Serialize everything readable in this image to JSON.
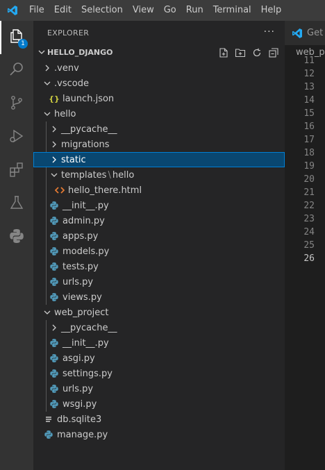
{
  "menu": [
    "File",
    "Edit",
    "Selection",
    "View",
    "Go",
    "Run",
    "Terminal",
    "Help"
  ],
  "activity": {
    "explorer_badge": "1"
  },
  "sidebar": {
    "title": "EXPLORER",
    "more": "···",
    "section_title": "HELLO_DJANGO",
    "items": [
      {
        "label": ".venv"
      },
      {
        "label": ".vscode"
      },
      {
        "label": "launch.json"
      },
      {
        "label": "hello"
      },
      {
        "label": "__pycache__"
      },
      {
        "label": "migrations"
      },
      {
        "label": "static"
      },
      {
        "label": "templates",
        "suffix": "hello"
      },
      {
        "label": "hello_there.html"
      },
      {
        "label": "__init__.py"
      },
      {
        "label": "admin.py"
      },
      {
        "label": "apps.py"
      },
      {
        "label": "models.py"
      },
      {
        "label": "tests.py"
      },
      {
        "label": "urls.py"
      },
      {
        "label": "views.py"
      },
      {
        "label": "web_project"
      },
      {
        "label": "__pycache__"
      },
      {
        "label": "__init__.py"
      },
      {
        "label": "asgi.py"
      },
      {
        "label": "settings.py"
      },
      {
        "label": "urls.py"
      },
      {
        "label": "wsgi.py"
      },
      {
        "label": "db.sqlite3"
      },
      {
        "label": "manage.py"
      }
    ]
  },
  "editor": {
    "tab_label": "Get Started",
    "breadcrumb": "web_project",
    "line_numbers": [
      "11",
      "12",
      "13",
      "14",
      "15",
      "16",
      "17",
      "18",
      "19",
      "20",
      "21",
      "22",
      "23",
      "24",
      "25",
      "26"
    ]
  },
  "colors": {
    "accent": "#007acc",
    "selection": "#094771",
    "python_blue": "#519aba",
    "html_orange": "#e37933",
    "json_yellow": "#cbcb41"
  }
}
